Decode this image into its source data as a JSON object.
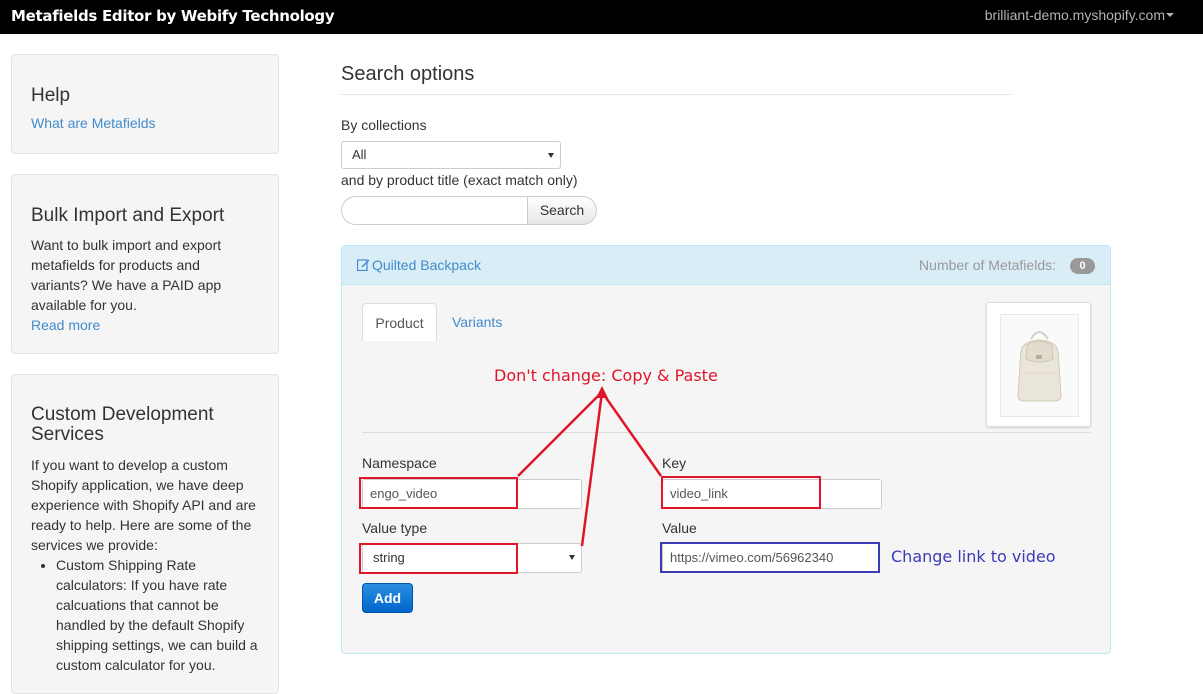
{
  "navbar": {
    "brand": "Metafields Editor by Webify Technology",
    "shop": "brilliant-demo.myshopify.com"
  },
  "sidebar": {
    "help": {
      "title": "Help",
      "link": "What are Metafields"
    },
    "bulk": {
      "title": "Bulk Import and Export",
      "text": "Want to bulk import and export metafields for products and variants? We have a PAID app available for you.",
      "link": "Read more"
    },
    "custom": {
      "title": "Custom Development Services",
      "text": "If you want to develop a custom Shopify application, we have deep experience with Shopify API and are ready to help. Here are some of the services we provide:",
      "items": [
        "Custom Shipping Rate calculators: If you have rate calcuations that cannot be handled by the default Shopify shipping settings, we can build a custom calculator for you."
      ]
    }
  },
  "search": {
    "title": "Search options",
    "collections_label": "By collections",
    "collections_value": "All",
    "title_label": "and by product title (exact match only)",
    "input_value": "",
    "button": "Search"
  },
  "product": {
    "title": "Quilted Backpack",
    "count_label": "Number of Metafields:",
    "count": "0",
    "tabs": [
      "Product",
      "Variants"
    ],
    "form": {
      "namespace_label": "Namespace",
      "namespace_value": "engo_video",
      "key_label": "Key",
      "key_value": "video_link",
      "value_type_label": "Value type",
      "value_type_value": "string",
      "value_label": "Value",
      "value_value": "https://vimeo.com/56962340",
      "add_button": "Add"
    }
  },
  "annotations": {
    "copy_note": "Don't change: Copy & Paste",
    "link_note": "Change link to video",
    "red_color": "#e0152a",
    "blue_color": "#3b3bb8"
  },
  "icons": {
    "edit": "edit-icon",
    "caret": "caret-down-icon",
    "select_arrow": "chevron-down-icon",
    "product_image": "backpack-image"
  }
}
